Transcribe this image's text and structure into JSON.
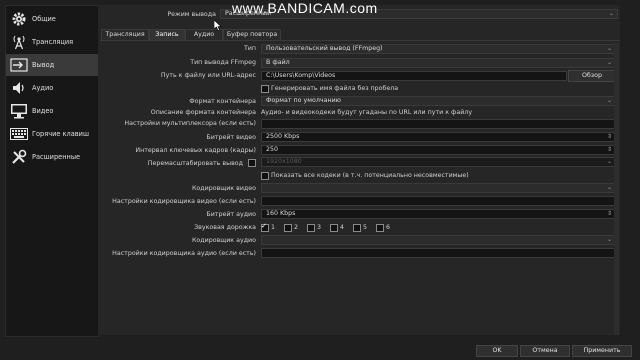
{
  "watermark": "www.BANDICAM.com",
  "sidebar": {
    "items": [
      {
        "label": "Общие",
        "icon": "gear-icon"
      },
      {
        "label": "Трансляция",
        "icon": "broadcast-icon"
      },
      {
        "label": "Вывод",
        "icon": "output-icon"
      },
      {
        "label": "Аудио",
        "icon": "speaker-icon"
      },
      {
        "label": "Видео",
        "icon": "monitor-icon"
      },
      {
        "label": "Горячие клавиш",
        "icon": "keyboard-icon"
      },
      {
        "label": "Расширенные",
        "icon": "tools-icon"
      }
    ],
    "active_index": 2
  },
  "output_mode": {
    "label": "Режим вывода",
    "value": "Расширенный"
  },
  "tabs": [
    "Трансляция",
    "Запись",
    "Аудио",
    "Буфер повтора"
  ],
  "active_tab": "Запись",
  "form": {
    "type_label": "Тип",
    "type_value": "Пользовательский вывод (FFmpeg)",
    "ffmpeg_type_label": "Тип вывода FFmpeg",
    "ffmpeg_type_value": "В файл",
    "path_label": "Путь к файлу или URL-адрес",
    "path_value": "C:\\Users\\Komp\\Videos",
    "browse_label": "Обзор",
    "no_space_label": "Генерировать имя файла без пробела",
    "container_label": "Формат контейнера",
    "container_value": "Формат по умолчанию",
    "container_desc_label": "Описание формата контейнера",
    "container_desc_value": "Аудио- и видеокодеки будут угаданы по URL или пути к файлу",
    "mux_label": "Настройки мультиплексора (если есть)",
    "vbitrate_label": "Битрейт видео",
    "vbitrate_value": "2500 Kbps",
    "keyint_label": "Интервал ключевых кадров (кадры)",
    "keyint_value": "250",
    "rescale_label": "Перемасштабировать вывод",
    "rescale_value": "1920x1080",
    "show_all_codecs_label": "Показать все кодеки (в т.ч. потенциально несовместимые)",
    "vencoder_label": "Кодировщик видео",
    "vencoder_settings_label": "Настройки кодировщика видео (если есть)",
    "abitrate_label": "Битрейт аудио",
    "abitrate_value": "160 Kbps",
    "audio_track_label": "Звуковая дорожка",
    "tracks": [
      "1",
      "2",
      "3",
      "4",
      "5",
      "6"
    ],
    "aencoder_label": "Кодировщик аудио",
    "aencoder_settings_label": "Настройки кодировщика аудио (если есть)"
  },
  "footer": {
    "ok": "OK",
    "cancel": "Отмена",
    "apply": "Применить"
  }
}
